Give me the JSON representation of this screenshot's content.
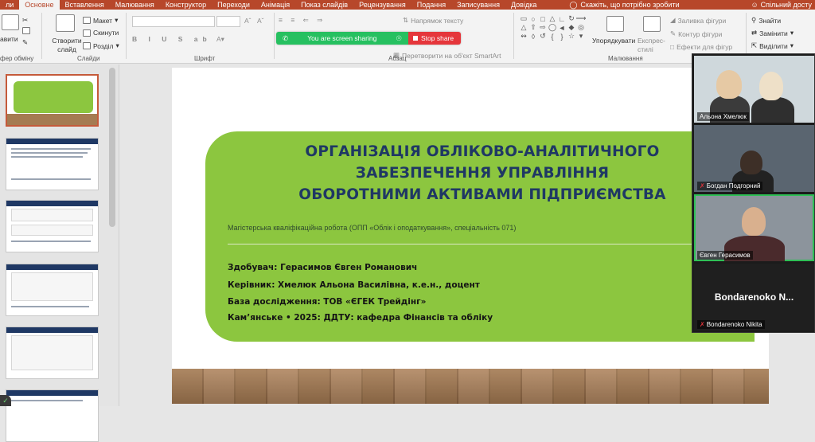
{
  "ribbon": {
    "tabs": [
      "ли",
      "Основне",
      "Вставлення",
      "Малювання",
      "Конструктор",
      "Переходи",
      "Анімація",
      "Показ слайдів",
      "Рецензування",
      "Подання",
      "Записування",
      "Довідка"
    ],
    "active_tab": "Основне",
    "tell_me": "Скажіть, що потрібно зробити",
    "share": "Спільний досту",
    "groups": {
      "clipboard": {
        "paste": "авити",
        "label": "фер обміну"
      },
      "slides": {
        "new_slide": "Створити слайд",
        "layout": "Макет",
        "reset": "Скинути",
        "section": "Розділ",
        "label": "Слайди"
      },
      "font": {
        "label": "Шрифт"
      },
      "paragraph": {
        "text_direction": "Напрямок тексту",
        "smartart": "Перетворити на об'єкт SmartArt",
        "label": "Абзац"
      },
      "drawing": {
        "arrange": "Упорядкувати",
        "quick_styles": "Експрес-стилі",
        "fill": "Заливка фігури",
        "outline": "Контур фігури",
        "effects": "Ефекти для фігур",
        "label": "Малювання"
      },
      "editing": {
        "find": "Знайти",
        "replace": "Замінити",
        "select": "Виділити"
      }
    }
  },
  "screen_share": {
    "status": "You are screen sharing",
    "stop": "Stop share"
  },
  "slide": {
    "title": [
      "ОРГАНІЗАЦІЯ ОБЛІКОВО-АНАЛІТИЧНОГО",
      "ЗАБЕЗПЕЧЕННЯ УПРАВЛІННЯ",
      "ОБОРОТНИМИ АКТИВАМИ ПІДПРИЄМСТВА"
    ],
    "subtitle": "Магістерська кваліфікаційна робота (ОПП «Облік і оподаткування», спеціальність 071)",
    "info": [
      "Здобувач: Герасимов Євген Романович",
      "Керівник: Хмелюк Альона Василівна, к.е.н., доцент",
      "База дослідження: ТОВ «ЄГЕК Трейдінг»",
      "Кам’янське • 2025: ДДТУ: кафедра Фінансів та обліку"
    ]
  },
  "participants": [
    {
      "name": "Альона Хмелюк",
      "muted": false
    },
    {
      "name": "Богдан Подгорний",
      "muted": true
    },
    {
      "name": "Євген Герасимов",
      "muted": false,
      "active": true
    },
    {
      "name": "Bondarenoko Nikita",
      "display": "Bondarenoko N...",
      "muted": true
    }
  ],
  "colors": {
    "accent": "#b7472a",
    "slide_green": "#8cc63f",
    "title_navy": "#1f3864",
    "share_green": "#26c060",
    "share_red": "#e5363b"
  }
}
